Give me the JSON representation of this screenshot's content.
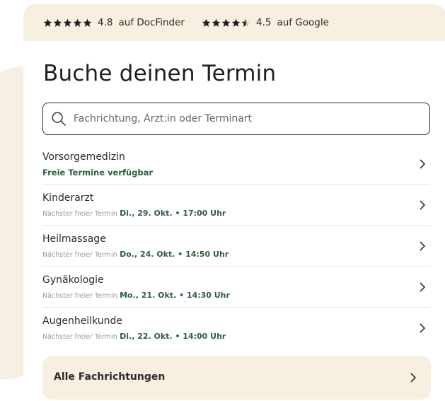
{
  "ratings": [
    {
      "stars": 5,
      "value": "4.8",
      "source_text": "auf DocFinder"
    },
    {
      "stars": 4.5,
      "value": "4.5",
      "source_text": "auf Google"
    }
  ],
  "colors": {
    "accent_bg": "#f7efe0",
    "green_text": "#2e5f3f"
  },
  "title": "Buche deinen Termin",
  "search": {
    "placeholder": "Fachrichtung, Ärzt:in oder Terminart",
    "value": ""
  },
  "specialties": [
    {
      "name": "Vorsorgemedizin",
      "free_label": "Freie Termine verfügbar"
    },
    {
      "name": "Kinderarzt",
      "prefix": "Nächster freier Termin",
      "date": "Di., 29. Okt. • 17:00 Uhr"
    },
    {
      "name": "Heilmassage",
      "prefix": "Nächster freier Termin",
      "date": "Do., 24. Okt. • 14:50 Uhr"
    },
    {
      "name": "Gynäkologie",
      "prefix": "Nächster freier Termin",
      "date": "Mo., 21. Okt. • 14:30 Uhr"
    },
    {
      "name": "Augenheilkunde",
      "prefix": "Nächster freier Termin",
      "date": "Di., 22. Okt. • 14:00 Uhr"
    }
  ],
  "all_button_label": "Alle Fachrichtungen"
}
